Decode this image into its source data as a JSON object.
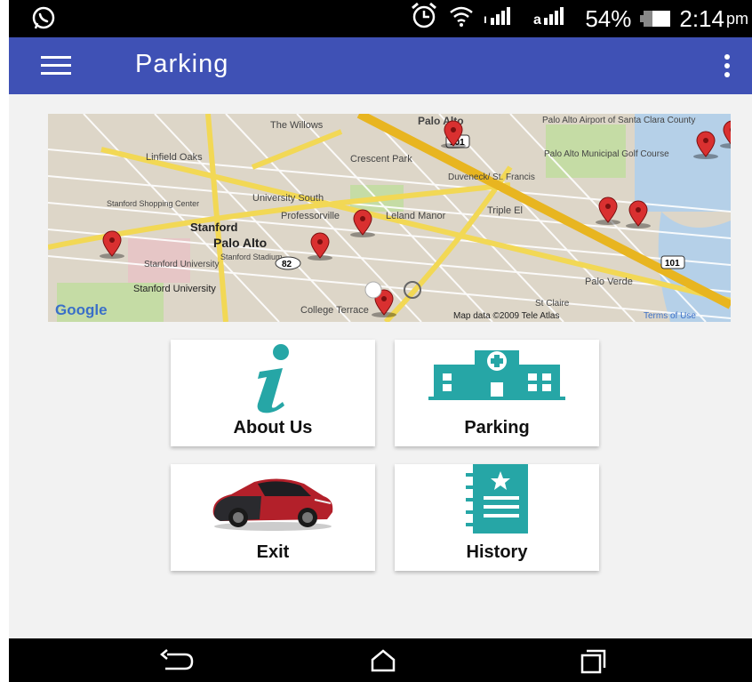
{
  "status_bar": {
    "battery": "54%",
    "time": "2:14",
    "time_suffix": "pm",
    "icons": [
      "whatsapp-icon",
      "alarm-icon",
      "wifi-icon",
      "signal-icon",
      "battery-icon"
    ]
  },
  "app_bar": {
    "title": "Parking",
    "menu_icon": "hamburger-menu-icon",
    "overflow_icon": "more-vert-icon",
    "color": "#3f51b5"
  },
  "map": {
    "labels": [
      "The Willows",
      "Palo Alto",
      "101",
      "Palo Alto Airport of Santa Clara County",
      "Linfield Oaks",
      "Crescent Park",
      "Palo Alto Municipal Golf Course",
      "Duveneck/ St. Francis",
      "Triple El",
      "Leland Manor",
      "Professorville",
      "University South",
      "Stanford",
      "Stanford Shopping Center",
      "Stanford University",
      "Stanford Stadium",
      "82",
      "Palo Verde",
      "College Terrace",
      "St Claire"
    ],
    "attribution": "Map data ©2009 Tele Atlas",
    "terms": "Terms of Use",
    "logo": "Google"
  },
  "tiles": [
    {
      "label": "About Us",
      "icon": "info-icon",
      "color": "#26a6a6"
    },
    {
      "label": "Parking",
      "icon": "hospital-building-icon",
      "color": "#26a6a6"
    },
    {
      "label": "Exit",
      "icon": "red-car-icon",
      "color": "#b3202a"
    },
    {
      "label": "History",
      "icon": "notebook-icon",
      "color": "#26a6a6"
    }
  ],
  "nav_bar": {
    "icons": [
      "back-icon",
      "home-icon",
      "recents-icon"
    ]
  }
}
